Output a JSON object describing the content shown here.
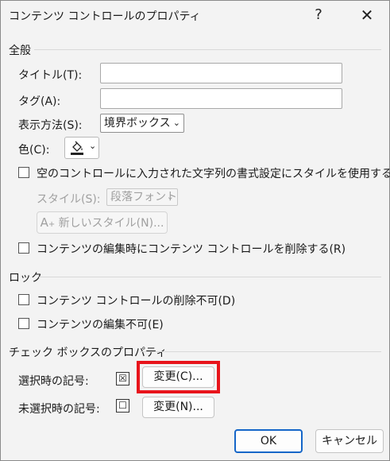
{
  "window": {
    "title": "コンテンツ コントロールのプロパティ",
    "help_label": "?",
    "close_label": "✕"
  },
  "general": {
    "heading": "全般",
    "title_label": "タイトル(T):",
    "title_value": "",
    "tag_label": "タグ(A):",
    "tag_value": "",
    "display_label": "表示方法(S):",
    "display_value": "境界ボックス",
    "color_label": "色(C):",
    "style_checkbox_label": "空のコントロールに入力された文字列の書式設定にスタイルを使用する(U)",
    "style_checked": false,
    "style_label": "スタイル(S):",
    "style_value": "段落フォント",
    "new_style_label": "新しいスタイル(N)...",
    "remove_checkbox_label": "コンテンツの編集時にコンテンツ コントロールを削除する(R)",
    "remove_checked": false
  },
  "lock": {
    "heading": "ロック",
    "no_delete_label": "コンテンツ コントロールの削除不可(D)",
    "no_delete_checked": false,
    "no_edit_label": "コンテンツの編集不可(E)",
    "no_edit_checked": false
  },
  "checkbox_props": {
    "heading": "チェック ボックスのプロパティ",
    "checked_symbol_label": "選択時の記号:",
    "checked_symbol": "☒",
    "change_checked_label": "変更(C)...",
    "unchecked_symbol_label": "未選択時の記号:",
    "unchecked_symbol": "☐",
    "change_unchecked_label": "変更(N)..."
  },
  "footer": {
    "ok_label": "OK",
    "cancel_label": "キャンセル"
  },
  "colors": {
    "highlight": "#e8141b",
    "ok_border": "#1566c8"
  }
}
